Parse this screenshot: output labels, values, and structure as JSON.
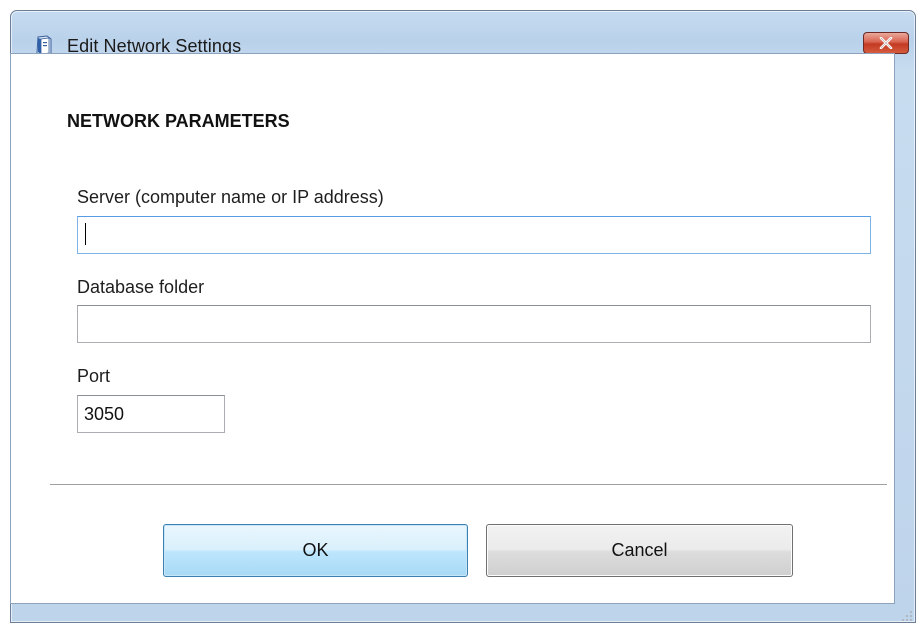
{
  "window": {
    "title": "Edit Network Settings",
    "app_icon": "database-icon",
    "close_icon": "close-icon"
  },
  "form": {
    "section_title": "NETWORK PARAMETERS",
    "server": {
      "label": "Server (computer name or IP address)",
      "value": "",
      "focused": true
    },
    "database_folder": {
      "label": "Database folder",
      "value": ""
    },
    "port": {
      "label": "Port",
      "value": "3050"
    }
  },
  "buttons": {
    "ok_label": "OK",
    "cancel_label": "Cancel"
  },
  "colors": {
    "title_bar": "#bfd5ec",
    "close_button": "#c8452c",
    "default_button_border": "#3c7fb1",
    "focus_border": "#7eb4ea"
  }
}
